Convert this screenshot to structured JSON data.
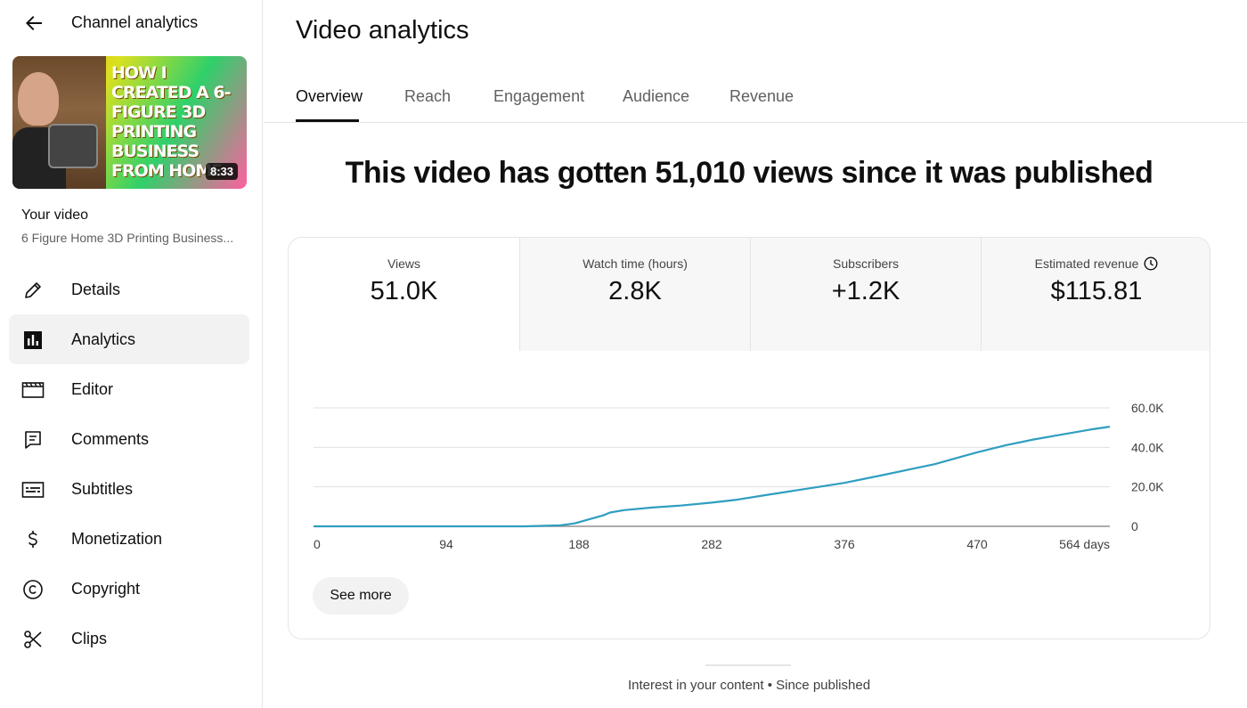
{
  "sidebar": {
    "title": "Channel analytics",
    "thumbnail": {
      "text": "How I created a 6-figure 3D printing business from home",
      "duration": "8:33"
    },
    "your_video_label": "Your video",
    "video_title": "6 Figure Home 3D Printing Business...",
    "items": [
      {
        "label": "Details",
        "icon": "pencil-icon"
      },
      {
        "label": "Analytics",
        "icon": "analytics-icon",
        "active": true
      },
      {
        "label": "Editor",
        "icon": "clapperboard-icon"
      },
      {
        "label": "Comments",
        "icon": "comment-icon"
      },
      {
        "label": "Subtitles",
        "icon": "subtitles-icon"
      },
      {
        "label": "Monetization",
        "icon": "dollar-icon"
      },
      {
        "label": "Copyright",
        "icon": "copyright-icon"
      },
      {
        "label": "Clips",
        "icon": "scissors-icon"
      }
    ]
  },
  "main": {
    "title": "Video analytics",
    "tabs": [
      {
        "label": "Overview",
        "active": true
      },
      {
        "label": "Reach"
      },
      {
        "label": "Engagement"
      },
      {
        "label": "Audience"
      },
      {
        "label": "Revenue"
      }
    ],
    "headline": "This video has gotten 51,010 views since it was published",
    "metrics": [
      {
        "label": "Views",
        "value": "51.0K"
      },
      {
        "label": "Watch time (hours)",
        "value": "2.8K"
      },
      {
        "label": "Subscribers",
        "value": "+1.2K"
      },
      {
        "label": "Estimated revenue",
        "value": "$115.81"
      }
    ],
    "see_more_label": "See more",
    "interest_text": "Interest in your content • Since published"
  },
  "colors": {
    "accent_line": "#2f9ec0",
    "active_bg": "#f2f2f2"
  },
  "chart_data": {
    "type": "line",
    "x_tick_labels": [
      "0",
      "94",
      "188",
      "282",
      "376",
      "470",
      "564 days"
    ],
    "y_tick_labels": [
      "0",
      "20.0K",
      "40.0K",
      "60.0K"
    ],
    "xlim": [
      0,
      564
    ],
    "ylim": [
      0,
      60000
    ],
    "grid": true,
    "series": [
      {
        "x": [
          0,
          150,
          175,
          185,
          195,
          205,
          210,
          220,
          240,
          260,
          282,
          300,
          320,
          340,
          360,
          376,
          400,
          420,
          440,
          460,
          470,
          490,
          510,
          530,
          550,
          564
        ],
        "y": [
          0,
          0,
          500,
          1500,
          3500,
          5500,
          7000,
          8200,
          9500,
          10500,
          12000,
          13500,
          15800,
          18000,
          20200,
          22000,
          25500,
          28500,
          31500,
          35500,
          37500,
          41000,
          44000,
          46500,
          49000,
          50500
        ]
      }
    ]
  }
}
